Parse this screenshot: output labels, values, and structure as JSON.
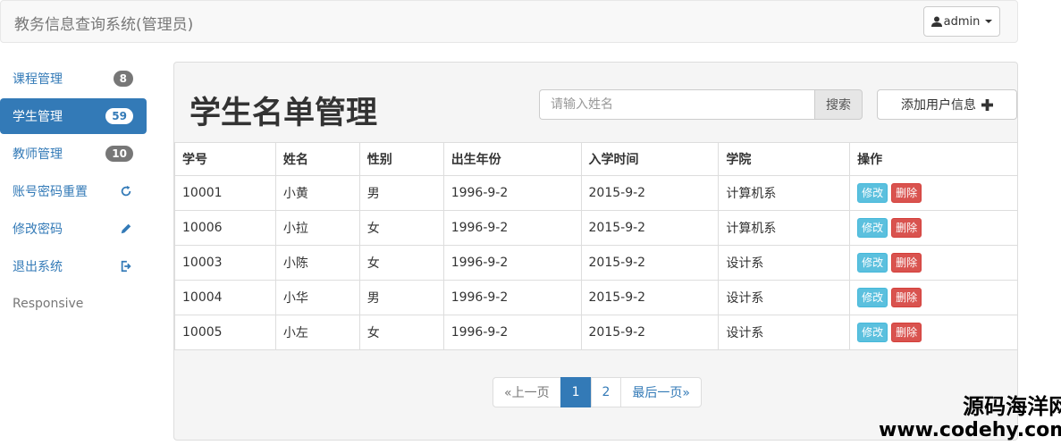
{
  "header": {
    "brand": "教务信息查询系统(管理员)",
    "user_label": "admin"
  },
  "sidebar": {
    "items": [
      {
        "label": "课程管理",
        "badge": "8"
      },
      {
        "label": "学生管理",
        "badge": "59"
      },
      {
        "label": "教师管理",
        "badge": "10"
      },
      {
        "label": "账号密码重置",
        "icon": "refresh-icon"
      },
      {
        "label": "修改密码",
        "icon": "pencil-icon"
      },
      {
        "label": "退出系统",
        "icon": "logout-icon"
      }
    ],
    "footer": "Responsive"
  },
  "main": {
    "title": "学生名单管理",
    "search_placeholder": "请输入姓名",
    "search_label": "搜索",
    "add_label": "添加用户信息",
    "table": {
      "headers": [
        "学号",
        "姓名",
        "性别",
        "出生年份",
        "入学时间",
        "学院",
        "操作"
      ],
      "rows": [
        [
          "10001",
          "小黄",
          "男",
          "1996-9-2",
          "2015-9-2",
          "计算机系"
        ],
        [
          "10006",
          "小拉",
          "女",
          "1996-9-2",
          "2015-9-2",
          "计算机系"
        ],
        [
          "10003",
          "小陈",
          "女",
          "1996-9-2",
          "2015-9-2",
          "设计系"
        ],
        [
          "10004",
          "小华",
          "男",
          "1996-9-2",
          "2015-9-2",
          "设计系"
        ],
        [
          "10005",
          "小左",
          "女",
          "1996-9-2",
          "2015-9-2",
          "设计系"
        ]
      ],
      "edit_label": "修改",
      "delete_label": "删除"
    },
    "pagination": {
      "prev": "«上一页",
      "pages": [
        "1",
        "2"
      ],
      "last": "最后一页»"
    }
  },
  "watermark": {
    "line1": "源码海洋网",
    "line2": "www.codehy.com"
  },
  "colors": {
    "primary": "#337ab7",
    "info": "#5bc0de",
    "danger": "#d9534f"
  }
}
